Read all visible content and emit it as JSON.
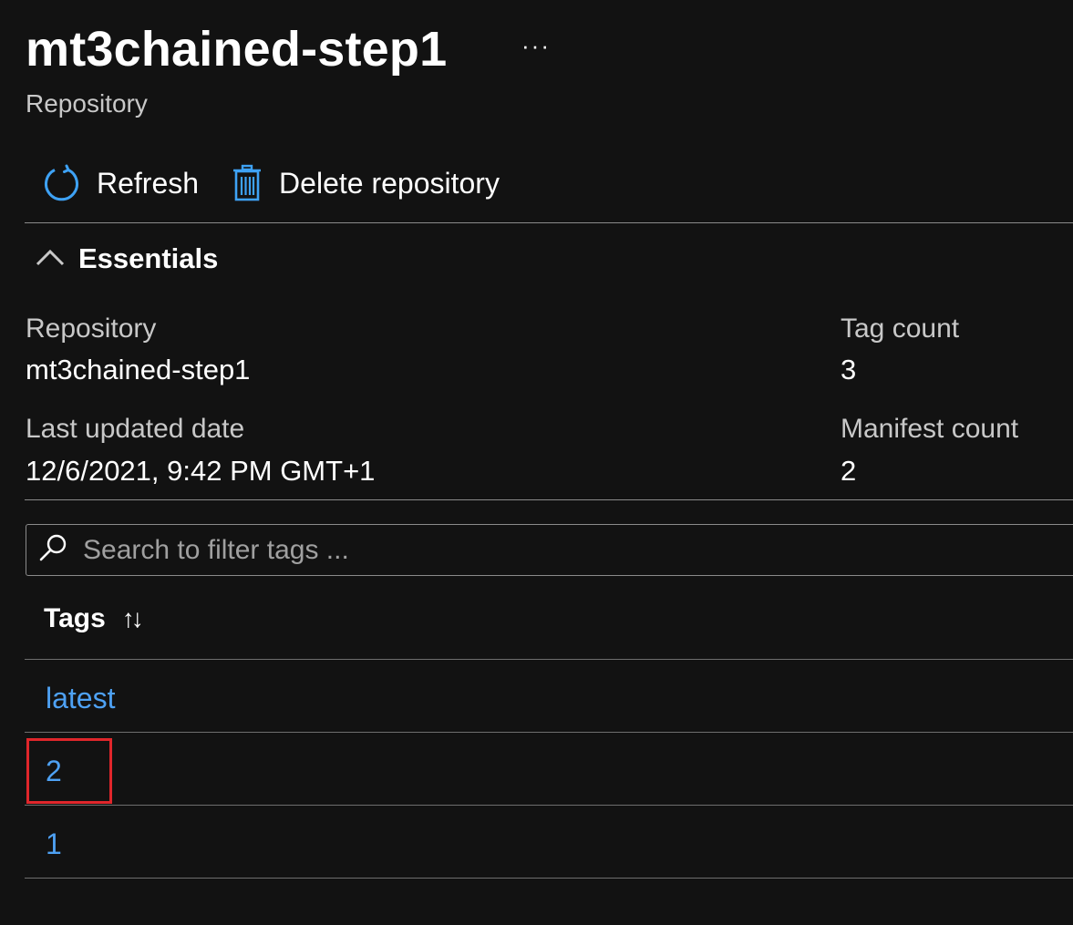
{
  "header": {
    "title": "mt3chained-step1",
    "more_label": "···",
    "subtitle": "Repository"
  },
  "toolbar": {
    "refresh_label": "Refresh",
    "refresh_icon": "refresh-icon",
    "delete_label": "Delete repository",
    "delete_icon": "trash-icon",
    "icon_color": "#3ea2f5"
  },
  "essentials": {
    "label": "Essentials",
    "expanded": true,
    "fields": {
      "repository": {
        "label": "Repository",
        "value": "mt3chained-step1"
      },
      "last_updated": {
        "label": "Last updated date",
        "value": "12/6/2021, 9:42 PM GMT+1"
      },
      "tag_count": {
        "label": "Tag count",
        "value": "3"
      },
      "manifest_count": {
        "label": "Manifest count",
        "value": "2"
      }
    }
  },
  "search": {
    "placeholder": "Search to filter tags ...",
    "value": ""
  },
  "tags_table": {
    "column_header": "Tags",
    "sort_icon": "↑↓",
    "rows": [
      {
        "tag": "latest"
      },
      {
        "tag": "2",
        "highlighted": true
      },
      {
        "tag": "1"
      }
    ],
    "link_color": "#4ea1f3",
    "highlight_color": "#e0262b"
  }
}
